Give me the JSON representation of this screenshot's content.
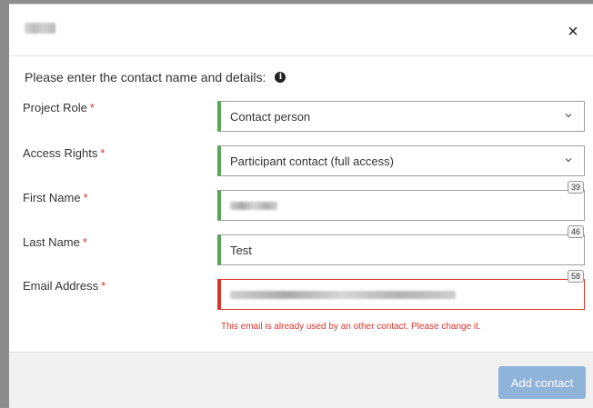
{
  "dialog": {
    "close_glyph": "×",
    "intro_text": "Please enter the contact name and details:",
    "info_glyph": "i"
  },
  "fields": {
    "project_role": {
      "label": "Project Role",
      "required_mark": "*",
      "value": "Contact person"
    },
    "access_rights": {
      "label": "Access Rights",
      "required_mark": "*",
      "value": "Participant contact (full access)"
    },
    "first_name": {
      "label": "First Name",
      "required_mark": "*",
      "counter": "39"
    },
    "last_name": {
      "label": "Last Name",
      "required_mark": "*",
      "value": "Test",
      "counter": "46"
    },
    "email": {
      "label": "Email Address",
      "required_mark": "*",
      "counter": "58",
      "error": "This email is already used by an other contact. Please change it."
    }
  },
  "footer": {
    "add_label": "Add contact"
  },
  "colors": {
    "valid_border": "#5aa55a",
    "error": "#d9342b",
    "primary_disabled": "#8fb3d9"
  },
  "icons": {
    "close": "close-icon",
    "info": "info-icon",
    "dropdown": "chevron-down-icon"
  }
}
